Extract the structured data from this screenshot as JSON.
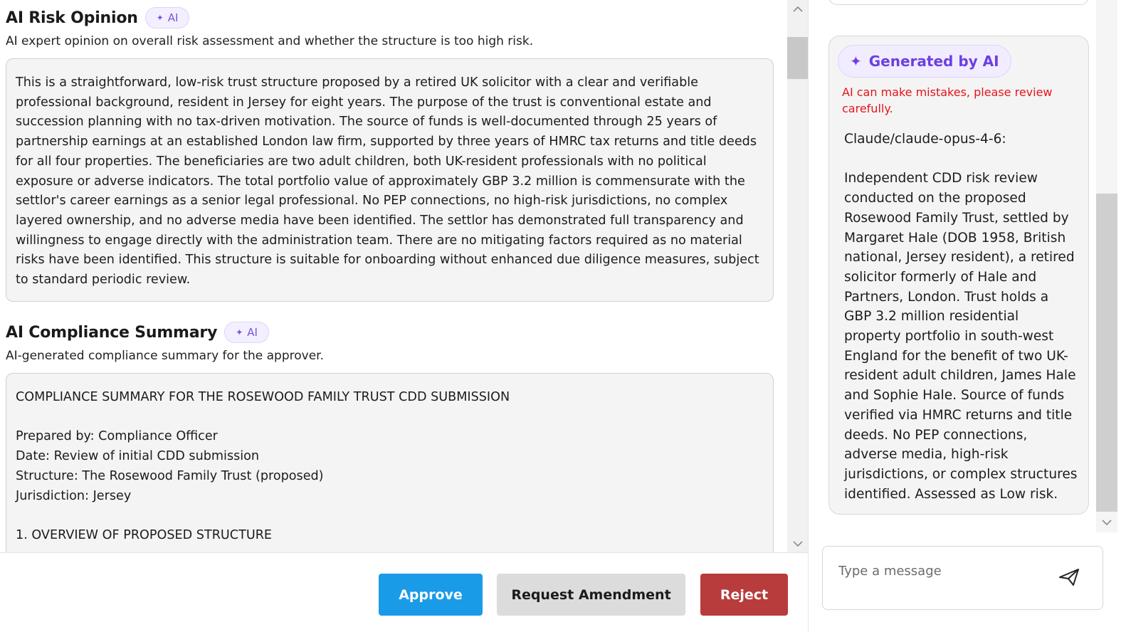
{
  "risk_opinion": {
    "title": "AI Risk Opinion",
    "ai_badge": "AI",
    "description": "AI expert opinion on overall risk assessment and whether the structure is too high risk.",
    "text": "This is a straightforward, low-risk trust structure proposed by a retired UK solicitor with a clear and verifiable professional background, resident in Jersey for eight years. The purpose of the trust is conventional estate and succession planning with no tax-driven motivation. The source of funds is well-documented through 25 years of partnership earnings at an established London law firm, supported by three years of HMRC tax returns and title deeds for all four properties. The beneficiaries are two adult children, both UK-resident professionals with no political exposure or adverse indicators. The total portfolio value of approximately GBP 3.2 million is commensurate with the settlor's career earnings as a senior legal professional. No PEP connections, no high-risk jurisdictions, no complex layered ownership, and no adverse media have been identified. The settlor has demonstrated full transparency and willingness to engage directly with the administration team. There are no mitigating factors required as no material risks have been identified. This structure is suitable for onboarding without enhanced due diligence measures, subject to standard periodic review."
  },
  "compliance_summary": {
    "title": "AI Compliance Summary",
    "ai_badge": "AI",
    "description": "AI-generated compliance summary for the approver.",
    "heading": "COMPLIANCE SUMMARY FOR THE ROSEWOOD FAMILY TRUST CDD SUBMISSION",
    "prepared_by": "Prepared by: Compliance Officer",
    "date": "Date: Review of initial CDD submission",
    "structure": "Structure: The Rosewood Family Trust (proposed)",
    "jurisdiction": "Jurisdiction: Jersey",
    "section_1": "1. OVERVIEW OF PROPOSED STRUCTURE"
  },
  "actions": {
    "approve": "Approve",
    "request_amendment": "Request Amendment",
    "reject": "Reject"
  },
  "chat": {
    "generated_label": "Generated by AI",
    "warning": "AI can make mistakes, please review carefully.",
    "model": "Claude/claude-opus-4-6:",
    "message": "Independent CDD risk review conducted on the proposed Rosewood Family Trust, settled by Margaret Hale (DOB 1958, British national, Jersey resident), a retired solicitor formerly of Hale and Partners, London. Trust holds a GBP 3.2 million residential property portfolio in south-west England for the benefit of two UK-resident adult children, James Hale and Sophie Hale. Source of funds verified via HMRC returns and title deeds. No PEP connections, adverse media, high-risk jurisdictions, or complex structures identified. Assessed as Low risk.",
    "input_placeholder": "Type a message"
  },
  "icons": {
    "sparkle": "sparkle-icon",
    "send": "send-icon",
    "scroll_up": "chevron-up-icon",
    "scroll_down": "chevron-down-icon"
  },
  "colors": {
    "approve": "#1a9be8",
    "amend": "#dcdcdc",
    "reject": "#b83c3c",
    "ai_accent": "#6d3fe0",
    "warning": "#e5141a"
  }
}
